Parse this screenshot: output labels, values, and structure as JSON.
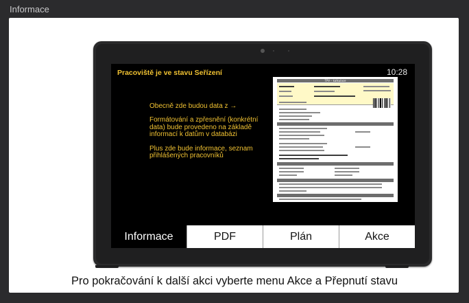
{
  "window": {
    "title": "Informace"
  },
  "screen": {
    "status_title": "Pracoviště je ve stavu Seřízení",
    "clock": "10:28",
    "info_lines": [
      "Obecně zde budou data z →",
      "Formátování a zpřesnění (konkrétní data) bude provedeno na základě informací k datům v databázi",
      "Plus zde bude informace, seznam přihlášených pracovníků"
    ],
    "document": {
      "header": "TPV – kalkulace"
    }
  },
  "tabs": [
    {
      "label": "Informace",
      "active": true
    },
    {
      "label": "PDF",
      "active": false
    },
    {
      "label": "Plán",
      "active": false
    },
    {
      "label": "Akce",
      "active": false
    }
  ],
  "caption": "Pro pokračování k další akci vyberte menu Akce a Přepnutí stavu",
  "colors": {
    "accent": "#f1c232",
    "window_bg": "#2b2b2d",
    "screen_bg": "#000000"
  }
}
